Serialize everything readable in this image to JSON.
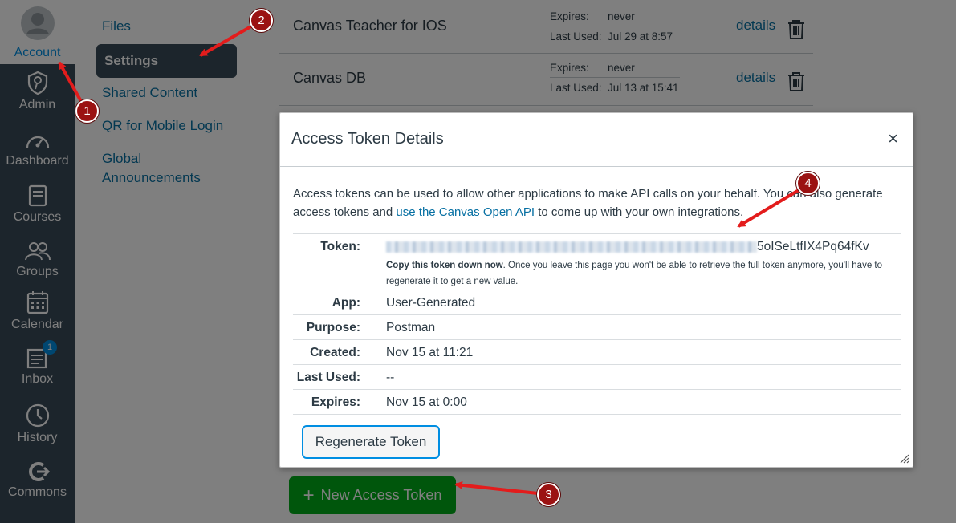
{
  "global_nav": {
    "items": [
      {
        "label": "Account",
        "icon": "account-avatar-icon"
      },
      {
        "label": "Admin",
        "icon": "admin-icon"
      },
      {
        "label": "Dashboard",
        "icon": "dashboard-icon"
      },
      {
        "label": "Courses",
        "icon": "courses-icon"
      },
      {
        "label": "Groups",
        "icon": "groups-icon"
      },
      {
        "label": "Calendar",
        "icon": "calendar-icon"
      },
      {
        "label": "Inbox",
        "icon": "inbox-icon",
        "badge": "1"
      },
      {
        "label": "History",
        "icon": "history-icon"
      },
      {
        "label": "Commons",
        "icon": "commons-icon"
      }
    ]
  },
  "sub_nav": {
    "items": [
      {
        "label": "Files"
      },
      {
        "label": "Settings"
      },
      {
        "label": "Shared Content"
      },
      {
        "label": "QR for Mobile Login"
      },
      {
        "label": "Global Announcements"
      }
    ]
  },
  "token_list": {
    "rows": [
      {
        "name": "Canvas Teacher for IOS",
        "expires_key": "Expires:",
        "expires": "never",
        "last_used_key": "Last Used:",
        "last_used": "Jul 29 at 8:57",
        "details": "details"
      },
      {
        "name": "Canvas DB",
        "expires_key": "Expires:",
        "expires": "never",
        "last_used_key": "Last Used:",
        "last_used": "Jul 13 at 15:41",
        "details": "details"
      }
    ],
    "new_token_label": "New Access Token"
  },
  "dialog": {
    "title": "Access Token Details",
    "close": "×",
    "intro_before": "Access tokens can be used to allow other applications to make API calls on your behalf. You can also generate access tokens and ",
    "intro_link": "use the Canvas Open API",
    "intro_after": " to come up with your own integrations.",
    "token_key": "Token:",
    "token_visible_tail": "5oISeLtfIX4Pq64fKv",
    "token_note_bold": "Copy this token down now",
    "token_note_rest": ". Once you leave this page you won't be able to retrieve the full token anymore, you'll have to regenerate it to get a new value.",
    "fields": [
      {
        "key": "App:",
        "value": "User-Generated"
      },
      {
        "key": "Purpose:",
        "value": "Postman"
      },
      {
        "key": "Created:",
        "value": "Nov 15 at 11:21"
      },
      {
        "key": "Last Used:",
        "value": "--"
      },
      {
        "key": "Expires:",
        "value": "Nov 15 at 0:00"
      }
    ],
    "regenerate_label": "Regenerate Token"
  },
  "callouts": [
    "1",
    "2",
    "3",
    "4"
  ],
  "colors": {
    "nav_bg": "#394b58",
    "link": "#0770a3",
    "accent": "#008ee2",
    "new_button": "#00ac18",
    "callout": "#9b1212",
    "arrow": "#e31c1c"
  }
}
